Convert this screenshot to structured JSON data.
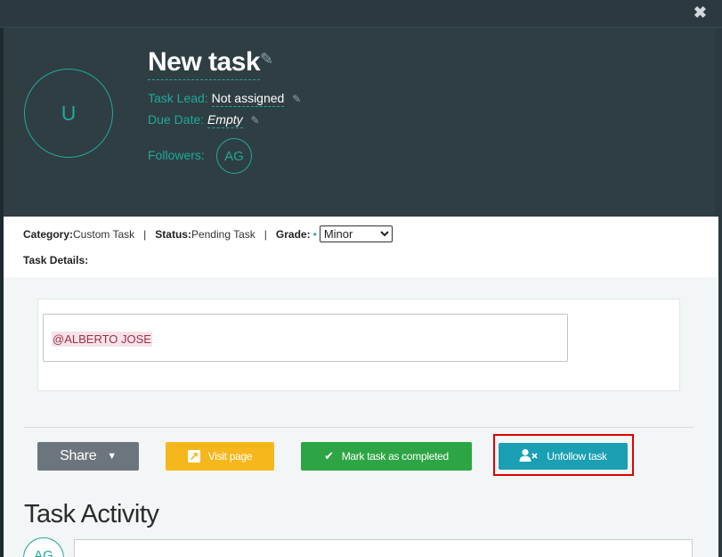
{
  "window": {
    "close_label": "✖"
  },
  "task": {
    "title": "New task",
    "avatar_initial": "U",
    "task_lead_label": "Task Lead:",
    "task_lead_value": "Not assigned",
    "due_date_label": "Due Date:",
    "due_date_value": "Empty",
    "followers_label": "Followers:",
    "followers": [
      "AG"
    ]
  },
  "info": {
    "category_label": "Category:",
    "category_value": "Custom Task",
    "status_label": "Status:",
    "status_value": "Pending Task",
    "grade_label": "Grade:",
    "grade_value": "Minor",
    "grade_options": [
      "Minor"
    ],
    "separator": "|",
    "details_label": "Task Details:"
  },
  "details": {
    "mention": "@ALBERTO JOSE"
  },
  "actions": {
    "share_label": "Share",
    "visit_label": "Visit page",
    "complete_label": "Mark task as completed",
    "unfollow_label": "Unfollow task"
  },
  "activity": {
    "title": "Task Activity",
    "avatar_initials": "AG"
  },
  "colors": {
    "accent": "#1fa99b",
    "header_bg": "#2f3e43",
    "share": "#6c757d",
    "visit": "#f6b71c",
    "complete": "#2da544",
    "unfollow": "#1a9fb3",
    "highlight": "#e00000"
  }
}
